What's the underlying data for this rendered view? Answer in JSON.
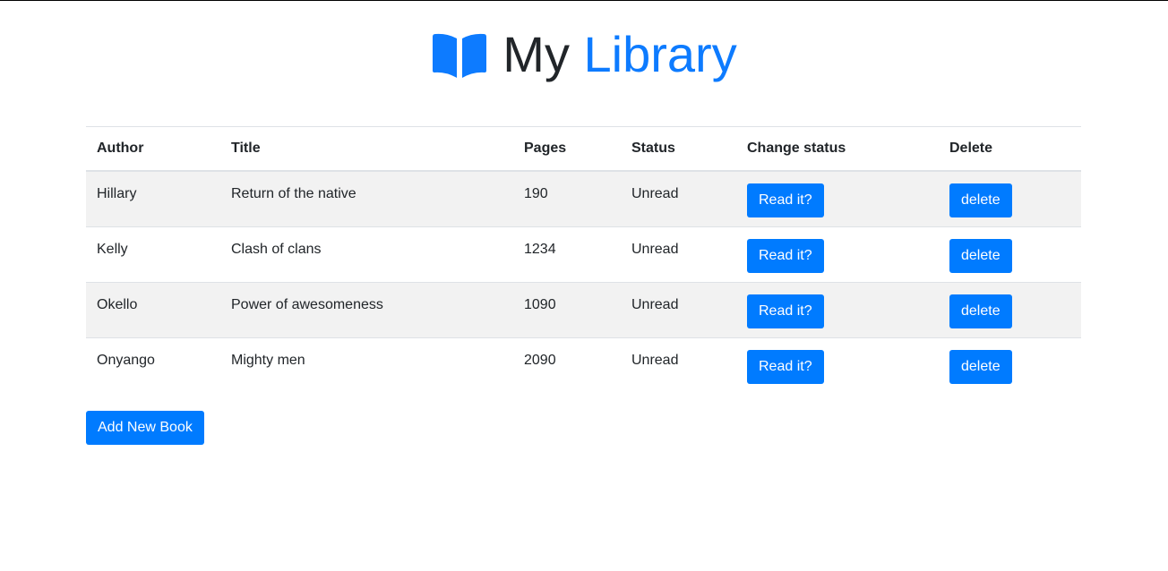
{
  "header": {
    "title_part1": "My",
    "title_part2": "Library",
    "icon": "book-open-icon",
    "accent_color": "#0d7bff"
  },
  "table": {
    "columns": [
      "Author",
      "Title",
      "Pages",
      "Status",
      "Change status",
      "Delete"
    ],
    "rows": [
      {
        "author": "Hillary",
        "title": "Return of the native",
        "pages": "190",
        "status": "Unread",
        "change_label": "Read it?",
        "delete_label": "delete"
      },
      {
        "author": "Kelly",
        "title": "Clash of clans",
        "pages": "1234",
        "status": "Unread",
        "change_label": "Read it?",
        "delete_label": "delete"
      },
      {
        "author": "Okello",
        "title": "Power of awesomeness",
        "pages": "1090",
        "status": "Unread",
        "change_label": "Read it?",
        "delete_label": "delete"
      },
      {
        "author": "Onyango",
        "title": "Mighty men",
        "pages": "2090",
        "status": "Unread",
        "change_label": "Read it?",
        "delete_label": "delete"
      }
    ]
  },
  "actions": {
    "add_label": "Add New Book"
  },
  "colors": {
    "primary": "#007bff",
    "stripe": "#f2f2f2"
  }
}
